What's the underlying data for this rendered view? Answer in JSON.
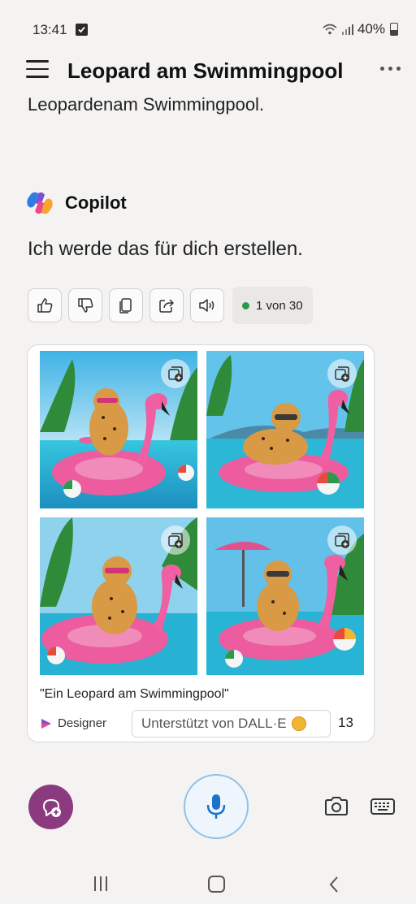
{
  "status_bar": {
    "time": "13:41",
    "battery": "40%"
  },
  "header": {
    "title": "Leopard am Swimmingpool"
  },
  "conversation": {
    "user_message": "Leopardenam Swimmingpool.",
    "assistant_name": "Copilot",
    "assistant_message": "Ich werde das für dich erstellen."
  },
  "actions": {
    "counter": "1 von 30"
  },
  "image_card": {
    "caption": "\"Ein Leopard am Swimmingpool\"",
    "designer_label": "Designer",
    "powered_by": "Unterstützt von DALL·E",
    "coin_count": "13"
  },
  "icons": [
    "menu-icon",
    "more-icon",
    "copilot-logo-icon",
    "thumbs-up-icon",
    "thumbs-down-icon",
    "copy-icon",
    "share-icon",
    "speaker-icon",
    "save-to-collection-icon",
    "designer-logo-icon",
    "coin-icon",
    "new-chat-icon",
    "microphone-icon",
    "camera-icon",
    "keyboard-icon"
  ],
  "colors": {
    "accent": "#1a73c8",
    "new_chat": "#8b3a7f",
    "counter_dot": "#2a9a4a",
    "flamingo": "#ea5a9c"
  }
}
